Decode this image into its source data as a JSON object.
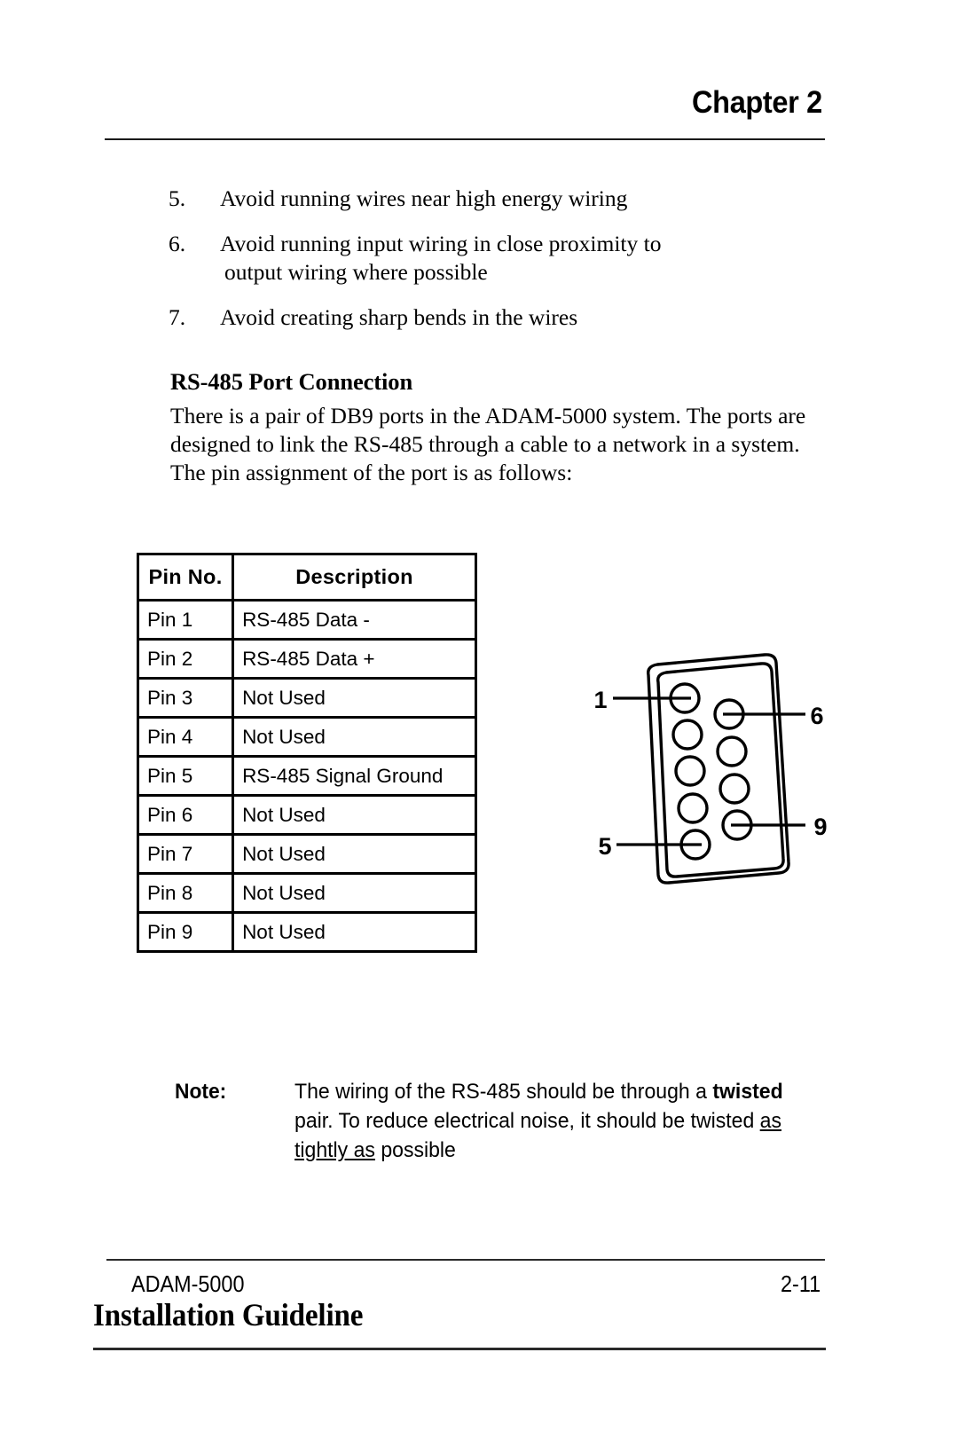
{
  "header": {
    "chapter_title": "Chapter 2"
  },
  "numbered_list": [
    {
      "number": "5.",
      "text": "Avoid running wires near high energy wiring",
      "continuation": ""
    },
    {
      "number": "6.",
      "text": "Avoid running input wiring in close proximity to",
      "continuation": "output wiring where possible"
    },
    {
      "number": "7.",
      "text": "Avoid creating sharp bends in the wires",
      "continuation": ""
    }
  ],
  "section": {
    "heading": "RS-485 Port Connection",
    "paragraph": "There is a pair of DB9 ports in the ADAM-5000 system. The ports are designed to link the RS-485 through a cable to a network in a system. The pin assignment of the port is as follows:"
  },
  "pin_table": {
    "columns": [
      "Pin No.",
      "Description"
    ],
    "rows": [
      {
        "pin": "Pin 1",
        "description": "RS-485 Data -"
      },
      {
        "pin": "Pin 2",
        "description": "RS-485 Data +"
      },
      {
        "pin": "Pin 3",
        "description": "Not Used"
      },
      {
        "pin": "Pin 4",
        "description": "Not Used"
      },
      {
        "pin": "Pin 5",
        "description": "RS-485 Signal Ground"
      },
      {
        "pin": "Pin 6",
        "description": "Not Used"
      },
      {
        "pin": "Pin 7",
        "description": "Not Used"
      },
      {
        "pin": "Pin 8",
        "description": "Not Used"
      },
      {
        "pin": "Pin 9",
        "description": "Not Used"
      }
    ]
  },
  "db9_figure": {
    "labels": {
      "top_left": "1",
      "bottom_left": "5",
      "top_right": "6",
      "bottom_right": "9"
    },
    "left_column_pins": 5,
    "right_column_pins": 4
  },
  "note": {
    "label": "Note:",
    "line1_a": "The wiring of the RS-485 should be through a ",
    "line1_bold": "twisted",
    "line2": "pair.  To reduce electrical noise, it should be twisted ",
    "line3_underlined": "as tightly as",
    "line3_plain": " possible"
  },
  "footer": {
    "product": "ADAM-5000",
    "page_number": "2-11",
    "guideline": "Installation Guideline"
  }
}
